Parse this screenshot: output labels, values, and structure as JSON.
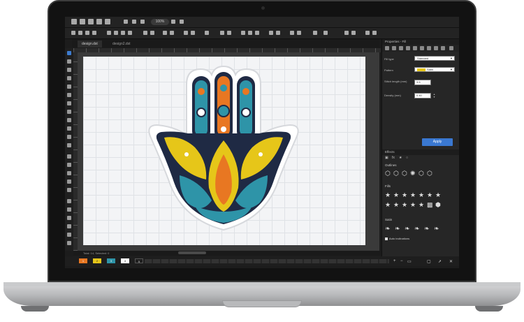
{
  "tabs": [
    {
      "label": "design.dst",
      "active": true
    },
    {
      "label": "design2.dst",
      "active": false
    }
  ],
  "toolbar": {
    "zoom_value": "100%"
  },
  "properties": {
    "title": "Properties - Fill",
    "fill_type_label": "Fill type",
    "fill_type_value": "Standard",
    "pattern_label": "Pattern",
    "pattern_value": "Satin",
    "pattern_color": "#e6c619",
    "stitch_length_label": "Stitch length (mm)",
    "stitch_length_value": "3.5",
    "density_label": "Density (mm)",
    "density_value": "0.40",
    "apply_label": "Apply"
  },
  "effects": {
    "title": "Effects",
    "outlines_label": "Outlines",
    "fills_label": "Fills",
    "satin_label": "Satin",
    "auto_inclinations_label": "Auto inclinations"
  },
  "status": {
    "text": "Total: 14, Selected: 0"
  },
  "palette": {
    "chips": [
      {
        "label": "1",
        "color": "#e87722"
      },
      {
        "label": "2",
        "color": "#e6c619"
      },
      {
        "label": "3",
        "color": "#2e94a8"
      },
      {
        "label": "4",
        "color": "#ffffff"
      },
      {
        "label": "5",
        "color": "#1e1e1e"
      }
    ]
  },
  "colors": {
    "accent": "#3a78d1",
    "dark_bg": "#1c1c1c",
    "teal": "#2e94a8",
    "orange": "#e87722",
    "yellow": "#e6c619",
    "navy": "#1f2a44"
  }
}
